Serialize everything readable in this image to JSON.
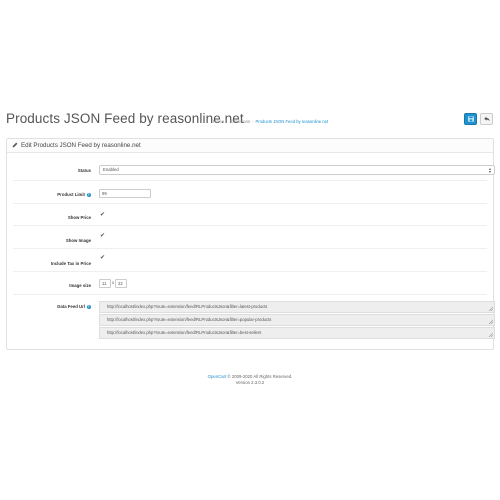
{
  "header": {
    "title": "Products JSON Feed by reasonline.net",
    "breadcrumb": [
      "Home",
      "Extensions",
      "Products JSON Feed by reasonline.net"
    ],
    "save_icon": "save-icon",
    "back_icon": "reply-icon"
  },
  "panel": {
    "title": "Edit Products JSON Feed by reasonline.net",
    "title_icon": "pencil-icon"
  },
  "form": {
    "status": {
      "label": "Status",
      "value": "Enabled"
    },
    "product_limit": {
      "label": "Product Limit",
      "value": "99"
    },
    "show_price": {
      "label": "Show Price",
      "checked": true
    },
    "show_image": {
      "label": "Show Image",
      "checked": true
    },
    "include_tax": {
      "label": "Include Tax in Price",
      "checked": true
    },
    "image_size": {
      "label": "Image size",
      "width": "11",
      "separator": "x",
      "height": "22"
    },
    "data_feed_url": {
      "label": "Data Feed Url",
      "urls": [
        "http://localhost/index.php?route=extension/feed/RLProductsJson&filter=latest-products",
        "http://localhost/index.php?route=extension/feed/RLProductsJson&filter=popular-products",
        "http://localhost/index.php?route=extension/feed/RLProductsJson&filter=best-sellers"
      ]
    }
  },
  "footer": {
    "link": "OpenCart",
    "copyright": "© 2009-2020 All Rights Reserved.",
    "version": "Version 2.3.0.2"
  }
}
